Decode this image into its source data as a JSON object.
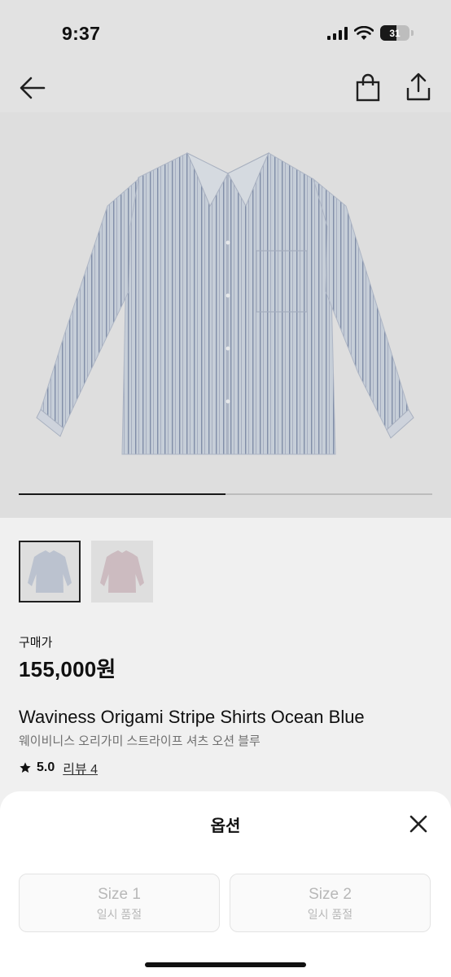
{
  "status_bar": {
    "time": "9:37",
    "battery": "31"
  },
  "product": {
    "price_label": "구매가",
    "price": "155,000원",
    "name_en": "Waviness Origami Stripe Shirts Ocean Blue",
    "name_ko": "웨이비니스 오리가미 스트라이프 셔츠 오션 블루",
    "rating_score": "5.0",
    "reviews": "리뷰 4",
    "image_progress": 0.5,
    "thumbnails": [
      "ocean-blue",
      "pink"
    ]
  },
  "options_sheet": {
    "title": "옵션",
    "options": [
      {
        "size": "Size 1",
        "status": "일시 품절"
      },
      {
        "size": "Size 2",
        "status": "일시 품절"
      }
    ]
  },
  "colors": {
    "background": "#ececec",
    "accent": "#111111",
    "disabled": "#b8b8b8",
    "shirt_blue": "#c7cfdc",
    "shirt_pink": "#d9c7cc"
  }
}
